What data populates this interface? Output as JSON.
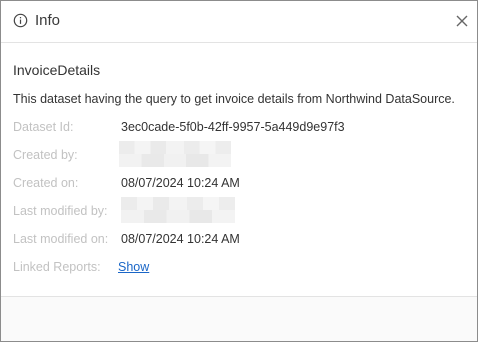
{
  "dialog": {
    "title": "Info",
    "close_icon": "close-icon",
    "info_icon": "info-icon"
  },
  "dataset": {
    "name": "InvoiceDetails",
    "description": "This dataset having the query to get invoice details from Northwind DataSource."
  },
  "details": {
    "dataset_id_label": "Dataset Id:",
    "dataset_id_value": "3ec0cade-5f0b-42ff-9957-5a449d9e97f3",
    "created_by_label": "Created by:",
    "created_on_label": "Created on:",
    "created_on_value": "08/07/2024 10:24 AM",
    "last_modified_by_label": "Last modified by:",
    "last_modified_on_label": "Last modified on:",
    "last_modified_on_value": "08/07/2024 10:24 AM",
    "linked_reports_label": "Linked Reports:",
    "linked_reports_link": "Show"
  },
  "colors": {
    "label": "#c2c2c2",
    "value": "#333333",
    "link": "#1a66c7",
    "border": "#8c8c8c"
  }
}
